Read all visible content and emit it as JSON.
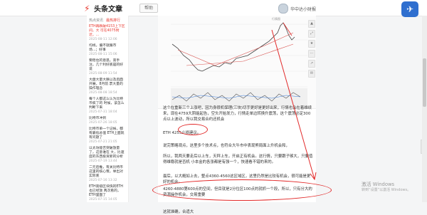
{
  "app": {
    "logo_text": "头条文章",
    "help_label": "帮助",
    "user_name": "华中达小财报",
    "colors": {
      "accent": "#e8382f",
      "fab": "#2f6fcf",
      "callout": "#e22a2a"
    }
  },
  "sidebar": {
    "tabs": [
      "热点资讯",
      "最热排行"
    ],
    "items": [
      {
        "title": "ETH再跌破4153上下区间，大 可在4075附近，...",
        "date": "2025-08-11 12:06",
        "hot": true
      },
      {
        "title": "均线，偏不就跟市场...；好事",
        "date": "2025-08-11 15:06",
        "hot": false
      },
      {
        "title": "要稳住的意思。高手注，几个利好底是的好说",
        "date": "2025-08-09 11:54",
        "hot": false
      },
      {
        "title": "大盘大量大跌以及后面开展，8月前 票大量的操作理念",
        "date": "2025-08-08 18:54",
        "hot": false
      },
      {
        "title": "每个人都这么认为比特币疯了的 时候，该怎么判断下来",
        "date": "2025-07-31 18:04",
        "hot": false
      },
      {
        "title": "比特币冲到",
        "date": "2025-07-26 18:05",
        "hot": false
      },
      {
        "title": "比特币单一个记帐，都有最低总值 ETH上面就有问题了",
        "date": "2025-07-21 21:05",
        "hot": false
      },
      {
        "title": "以太坊能否突破放量了，这意谁在 大，比速度的东西投资新的分析",
        "date": "2025-07-19 13:44",
        "hot": false
      },
      {
        "title": "二元后推，有关比特币这里的核心策，举出对实际底",
        "date": "2025-07-16 13:32",
        "hot": false
      },
      {
        "title": "ETH高级区块快的ETH也已经放 两次看的，ETH里面了",
        "date": "2025-07-15 14:05",
        "hot": false
      }
    ]
  },
  "article": {
    "chart_caption": "行情图",
    "paragraphs": [
      "这个在重新三个上涨吧，因为身很机保理(三块)切手更好是更好出来，行情也会在着维续来，现在4759大阴能起告，空头开始发力，行情走单边转换升震荡，这个震荡必定300点以上波动，所以我交易合约还机会",
      "ETH 4255止损建议。",
      "说完策略观点，这里多个技术点，也符合大牛市中表现熊局面上升机会和，",
      "所以，我两天要走后以上车，天秤上车，开启正有机会。这行情，只要跟子够大，只要值得维稳就是否机 小本金的各张都是有强一个，快速看不错的来的。",
      "最后，以大概如上去，整点4360-4560这区域区，这里仍然是比较有机会，很可能是更好的机会。",
      "4260-4880第600点的空间，但目就是2分位区100点的就抓一个段，所以，只有分大的资源操作机会，交易重要",
      "这就准确，合适大"
    ]
  },
  "tools": [
    "▲",
    "⤢",
    "★",
    "⋯",
    "↗",
    "✉"
  ],
  "watermark": {
    "line1": "激活 Windows",
    "line2": "转到“设置”以激活 Windows。"
  }
}
